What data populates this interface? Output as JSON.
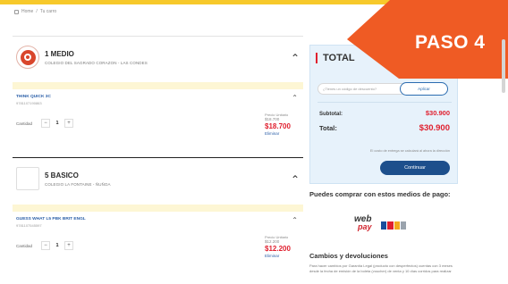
{
  "breadcrumb": {
    "home": "Home",
    "sep": "/",
    "current": "Tu carro"
  },
  "orders": [
    {
      "grade": "1 MEDIO",
      "school": "COLEGIO DEL SAGRADO CORAZON - LAS CONDES",
      "product": {
        "title": "THINK QUICK 3C",
        "sku": "9781107190863",
        "qty_label": "Cantidad",
        "qty": "1",
        "minus": "−",
        "plus": "+",
        "unit_label": "Precio Unitario",
        "unit_price": "$18.700",
        "total": "$18.700",
        "remove": "Eliminar"
      }
    },
    {
      "grade": "5 BASICO",
      "school": "COLEGIO LA FONTAINE - ÑUÑOA",
      "product": {
        "title": "GUESS WHAT L5 PBK BRIT ENGL",
        "sku": "9781107545597",
        "qty_label": "Cantidad",
        "qty": "1",
        "minus": "−",
        "plus": "+",
        "unit_label": "Precio Unitario",
        "unit_price": "$12.200",
        "total": "$12.200",
        "remove": "Eliminar"
      }
    }
  ],
  "summary": {
    "title": "TOTAL",
    "coupon_placeholder": "¿Tienes un código de descuento?",
    "coupon_button": "Aplicar",
    "subtotal_label": "Subtotal:",
    "subtotal_value": "$30.900",
    "total_label": "Total:",
    "total_value": "$30.900",
    "note": "El costo de entrega se calculará al ahora la dirección",
    "continue": "Continuar"
  },
  "payment": {
    "title": "Puedes comprar con estos medios de pago:",
    "logo_word1": "web",
    "logo_word2": "pay"
  },
  "cambios": {
    "title": "Cambios y devoluciones",
    "text": "Para hacer cambios por Garantía Legal (producto con desperfectos) cuentas con 3 meses desde la fecha de emisión de la boleta (voucher) de venta y 10 días corridos para realizar"
  },
  "banner": {
    "text": "PASO 4",
    "color": "#ef5b24"
  },
  "colors": {
    "accent_red": "#e0202f",
    "link_blue": "#2b5fa8",
    "topbar": "#f7c92b",
    "button_blue": "#1d4f8c"
  }
}
